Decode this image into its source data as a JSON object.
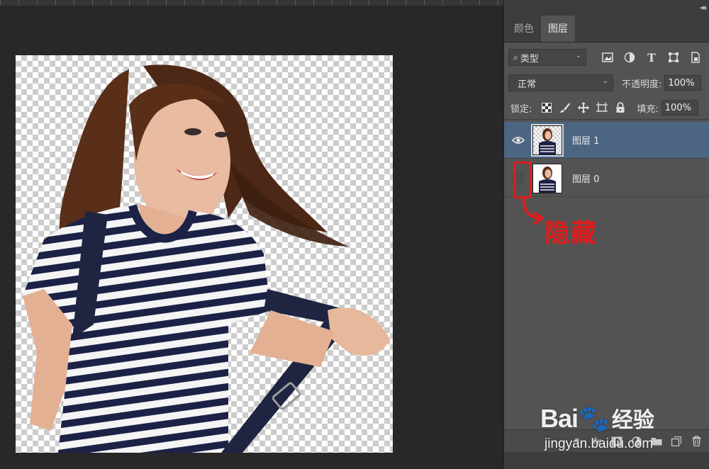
{
  "panel": {
    "tabs": [
      {
        "label": "颜色",
        "active": false
      },
      {
        "label": "图层",
        "active": true
      }
    ],
    "filter": {
      "label": "类型"
    },
    "blend_mode": "正常",
    "opacity_label": "不透明度:",
    "opacity_value": "100%",
    "lock_label": "锁定:",
    "fill_label": "填充:",
    "fill_value": "100%",
    "layers": [
      {
        "name": "图层 1",
        "visible": true,
        "selected": true
      },
      {
        "name": "图层 0",
        "visible": false,
        "selected": false
      }
    ]
  },
  "annotation": {
    "text": "隐藏",
    "color": "#e11c1c"
  },
  "watermark": {
    "logo": "Bai",
    "logo_cn": "经验",
    "url": "jingyan.baidu.com"
  },
  "colors": {
    "panel_bg": "#535353",
    "selected_layer": "#4c6682",
    "workspace": "#282828"
  }
}
